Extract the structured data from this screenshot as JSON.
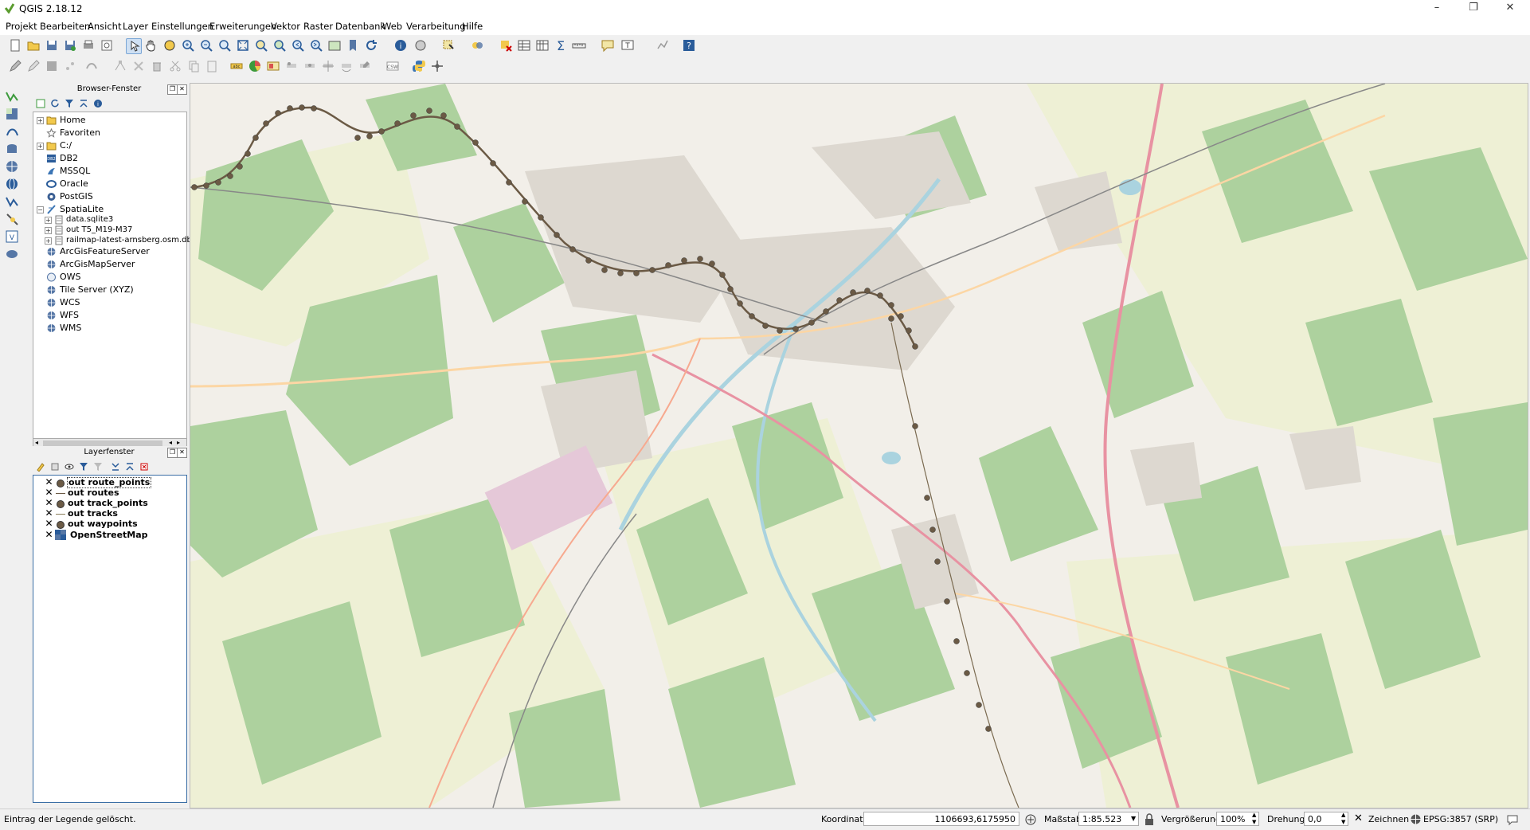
{
  "window": {
    "title": "QGIS 2.18.12",
    "minimize": "–",
    "maximize": "❐",
    "close": "✕"
  },
  "menu": [
    "Projekt",
    "Bearbeiten",
    "Ansicht",
    "Layer",
    "Einstellungen",
    "Erweiterungen",
    "Vektor",
    "Raster",
    "Datenbank",
    "Web",
    "Verarbeitung",
    "Hilfe"
  ],
  "browser_panel": {
    "title": "Browser-Fenster",
    "items": [
      {
        "label": "Home",
        "icon": "folder-icon",
        "expander": "+"
      },
      {
        "label": "Favoriten",
        "icon": "star-icon",
        "expander": ""
      },
      {
        "label": "C:/",
        "icon": "folder-icon",
        "expander": "+"
      },
      {
        "label": "DB2",
        "icon": "db2-icon",
        "expander": ""
      },
      {
        "label": "MSSQL",
        "icon": "mssql-icon",
        "expander": ""
      },
      {
        "label": "Oracle",
        "icon": "oracle-icon",
        "expander": ""
      },
      {
        "label": "PostGIS",
        "icon": "postgis-icon",
        "expander": ""
      },
      {
        "label": "SpatiaLite",
        "icon": "spatialite-icon",
        "expander": "−"
      },
      {
        "label": "data.sqlite3",
        "icon": "database-icon",
        "expander": "+"
      },
      {
        "label": "out T5_M19-M37",
        "icon": "database-icon",
        "expander": "+"
      },
      {
        "label": "railmap-latest-arnsberg.osm.db",
        "icon": "database-icon",
        "expander": "+"
      },
      {
        "label": "ArcGisFeatureServer",
        "icon": "globe-icon",
        "expander": ""
      },
      {
        "label": "ArcGisMapServer",
        "icon": "globe-icon",
        "expander": ""
      },
      {
        "label": "OWS",
        "icon": "globe-icon",
        "expander": ""
      },
      {
        "label": "Tile Server (XYZ)",
        "icon": "globe-icon",
        "expander": ""
      },
      {
        "label": "WCS",
        "icon": "globe-icon",
        "expander": ""
      },
      {
        "label": "WFS",
        "icon": "globe-icon",
        "expander": ""
      },
      {
        "label": "WMS",
        "icon": "globe-icon",
        "expander": ""
      }
    ]
  },
  "layer_panel": {
    "title": "Layerfenster",
    "layers": [
      {
        "label": "out route_points",
        "icon": "point-layer-icon",
        "visible": true
      },
      {
        "label": "out routes",
        "icon": "line-layer-icon",
        "visible": true
      },
      {
        "label": "out track_points",
        "icon": "point-layer-icon",
        "visible": true
      },
      {
        "label": "out tracks",
        "icon": "line-layer-icon",
        "visible": true
      },
      {
        "label": "out waypoints",
        "icon": "point-layer-icon",
        "visible": true
      },
      {
        "label": "OpenStreetMap",
        "icon": "raster-layer-icon",
        "visible": true
      }
    ]
  },
  "status": {
    "message": "Eintrag der Legende gelöscht.",
    "coord_label": "Koordinate",
    "coord_value": "1106693,6175950",
    "scale_label": "Maßstab",
    "scale_value": "1:85.523",
    "magnifier_label": "Vergrößerung",
    "magnifier_value": "100%",
    "rotation_label": "Drehung",
    "rotation_value": "0,0",
    "render_label": "Zeichnen",
    "crs": "EPSG:3857 (SRP)"
  },
  "colors": {
    "accent": "#3a6ea5",
    "forest": "#add19e",
    "road": "#e892a2",
    "water": "#aad3df",
    "track": "#6b5a45"
  }
}
